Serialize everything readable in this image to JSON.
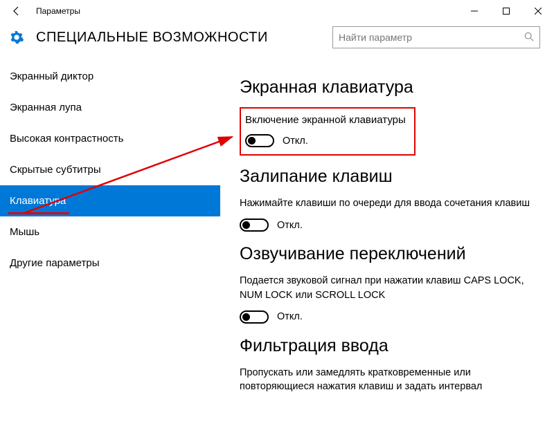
{
  "window": {
    "title": "Параметры"
  },
  "header": {
    "title": "Специальные возможности"
  },
  "search": {
    "placeholder": "Найти параметр"
  },
  "sidebar": {
    "items": [
      {
        "label": "Экранный диктор"
      },
      {
        "label": "Экранная лупа"
      },
      {
        "label": "Высокая контрастность"
      },
      {
        "label": "Скрытые субтитры"
      },
      {
        "label": "Клавиатура",
        "selected": true
      },
      {
        "label": "Мышь"
      },
      {
        "label": "Другие параметры"
      }
    ]
  },
  "content": {
    "section1": {
      "heading": "Экранная клавиатура",
      "sub": "Включение экранной клавиатуры",
      "toggle_state": "Откл."
    },
    "section2": {
      "heading": "Залипание клавиш",
      "desc": "Нажимайте клавиши по очереди для ввода сочетания клавиш",
      "toggle_state": "Откл."
    },
    "section3": {
      "heading": "Озвучивание переключений",
      "desc": "Подается звуковой сигнал при нажатии клавиш CAPS LOCK, NUM LOCK или SCROLL LOCK",
      "toggle_state": "Откл."
    },
    "section4": {
      "heading": "Фильтрация ввода",
      "desc": "Пропускать или замедлять кратковременные или повторяющиеся нажатия клавиш и задать интервал"
    }
  },
  "annotation": {
    "highlight_color": "#e00000"
  }
}
